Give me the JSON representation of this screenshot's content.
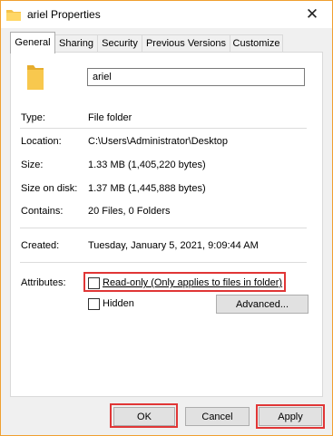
{
  "window": {
    "title": "ariel Properties"
  },
  "tabs": [
    {
      "label": "General"
    },
    {
      "label": "Sharing"
    },
    {
      "label": "Security"
    },
    {
      "label": "Previous Versions"
    },
    {
      "label": "Customize"
    }
  ],
  "general": {
    "name_value": "ariel",
    "type_label": "Type:",
    "type_value": "File folder",
    "location_label": "Location:",
    "location_value": "C:\\Users\\Administrator\\Desktop",
    "size_label": "Size:",
    "size_value": "1.33 MB (1,405,220 bytes)",
    "size_on_disk_label": "Size on disk:",
    "size_on_disk_value": "1.37 MB (1,445,888 bytes)",
    "contains_label": "Contains:",
    "contains_value": "20 Files, 0 Folders",
    "created_label": "Created:",
    "created_value": "Tuesday, January 5, 2021, 9:09:44 AM",
    "attributes_label": "Attributes:",
    "readonly_label": "Read-only (Only applies to files in folder)",
    "hidden_label": "Hidden",
    "advanced_label": "Advanced..."
  },
  "footer": {
    "ok_label": "OK",
    "cancel_label": "Cancel",
    "apply_label": "Apply"
  },
  "colors": {
    "highlight": "#e03636",
    "folder": "#f5c34a",
    "frame": "#f0a030"
  },
  "icons": {
    "title": "folder-icon",
    "big": "folder-icon",
    "close": "close-icon"
  }
}
